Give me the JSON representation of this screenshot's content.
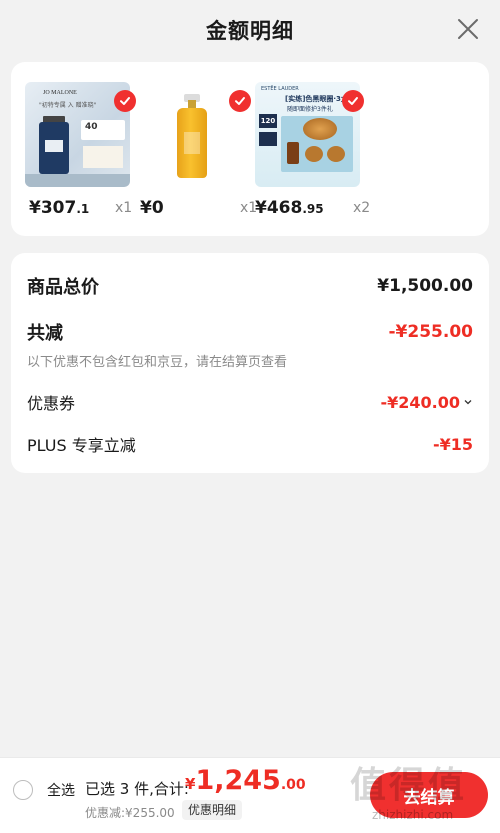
{
  "header": {
    "title": "金额明细",
    "close_icon": "close-icon"
  },
  "products": [
    {
      "name_icon": "jo-malone-perfume-image",
      "check_icon": "checkmark-icon",
      "price_int": "¥307",
      "price_dec": ".1",
      "qty": "x1",
      "thumb_text_brand": "JO MALONE",
      "thumb_text_tag": "\"初特专属 入 赠准晓\"",
      "thumb_text_badge": "40"
    },
    {
      "name_icon": "golden-oil-bottle-image",
      "check_icon": "checkmark-icon",
      "price_int": "¥0",
      "price_dec": "",
      "qty": "x1"
    },
    {
      "name_icon": "estee-lauder-set-image",
      "check_icon": "checkmark-icon",
      "price_int": "¥468",
      "price_dec": ".95",
      "qty": "x2",
      "thumb_text_brand": "ESTĒE LAUDER",
      "thumb_text_tag": "[实练]色黑眼圈·3大",
      "thumb_text_sub": "随即面修护3件礼",
      "thumb_text_badge": "120"
    }
  ],
  "summary": {
    "total_label": "商品总价",
    "total_value": "¥1,500.00",
    "reduce_label": "共减",
    "reduce_value": "-¥255.00",
    "reduce_note": "以下优惠不包含红包和京豆，请在结算页查看",
    "coupon_label": "优惠券",
    "coupon_value": "-¥240.00",
    "plus_label": "PLUS 专享立减",
    "plus_value": "-¥15"
  },
  "bottom_bar": {
    "select_all": "全选",
    "selected_text": "已选 3 件,合计:",
    "total_currency": "¥",
    "total_int": "1,245",
    "total_dec": ".00",
    "discount_text": "优惠减:¥255.00",
    "detail_chip": "优惠明细",
    "checkout_label": "去结算"
  },
  "watermark": {
    "big": "值得值",
    "small": "zhizhizhi.com"
  },
  "colors": {
    "accent": "#ee2d24",
    "check": "#f0302f",
    "background": "#f2f2f2"
  }
}
